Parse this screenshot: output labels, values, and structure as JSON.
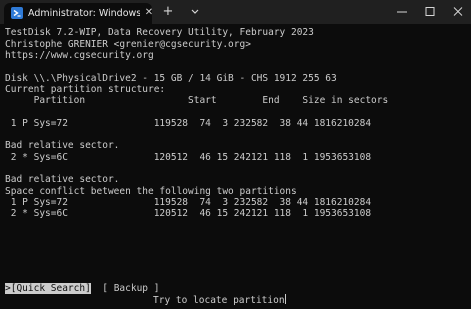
{
  "window": {
    "tab_title": "Administrator: Windows PowerShell",
    "tab_icon": "powershell-icon",
    "close_tab_glyph": "✕",
    "new_tab_glyph": "+",
    "dropdown_glyph": "⌄",
    "minimize_glyph": "—",
    "maximize_glyph": "☐",
    "close_glyph": "✕"
  },
  "terminal": {
    "header": [
      "TestDisk 7.2-WIP, Data Recovery Utility, February 2023",
      "Christophe GRENIER <grenier@cgsecurity.org>",
      "https://www.cgsecurity.org"
    ],
    "disk_line": "Disk \\\\.\\PhysicalDrive2 - 15 GB / 14 GiB - CHS 1912 255 63",
    "structure_label": "Current partition structure:",
    "table_header": "     Partition                  Start        End    Size in sectors",
    "partitions": [
      " 1 P Sys=72               119528  74  3 232582  38 44 1816210284",
      " 2 * Sys=6C               120512  46 15 242121 118  1 1953653108",
      " 1 P Sys=72               119528  74  3 232582  38 44 1816210284",
      " 2 * Sys=6C               120512  46 15 242121 118  1 1953653108"
    ],
    "messages": {
      "bad_sector_1": "Bad relative sector.",
      "bad_sector_2": "Bad relative sector.",
      "conflict": "Space conflict between the following two partitions"
    },
    "menu": {
      "quick_search": ">[Quick Search]",
      "backup": "[ Backup ]"
    },
    "hint": "Try to locate partition"
  },
  "colors": {
    "terminal_bg": "#0c0c0c",
    "terminal_fg": "#cccccc",
    "titlebar_bg": "#202020",
    "powershell_blue": "#2f7ad6"
  }
}
